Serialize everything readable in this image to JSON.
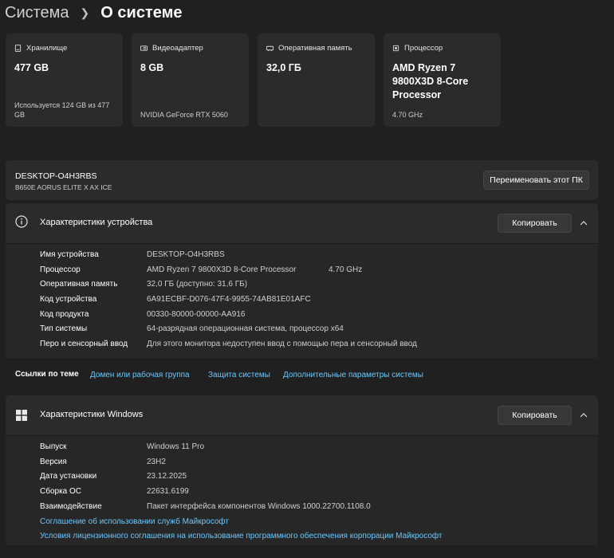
{
  "breadcrumb": {
    "parent": "Система",
    "current": "О системе"
  },
  "cards": [
    {
      "label": "Хранилище",
      "value": "477 GB",
      "sub": "Используется 124 GB из 477 GB",
      "icon": "storage-icon"
    },
    {
      "label": "Видеоадаптер",
      "value": "8 GB",
      "sub": "NVIDIA GeForce RTX 5060",
      "icon": "gpu-icon"
    },
    {
      "label": "Оперативная память",
      "value": "32,0 ГБ",
      "sub": "",
      "icon": "memory-icon"
    },
    {
      "label": "Процессор",
      "value": "AMD Ryzen 7 9800X3D 8-Core Processor",
      "sub": "4.70 GHz",
      "icon": "cpu-icon"
    }
  ],
  "device_bar": {
    "name": "DESKTOP-O4H3RBS",
    "model": "B650E AORUS ELITE X AX ICE",
    "rename_label": "Переименовать этот ПК"
  },
  "device_specs": {
    "title": "Характеристики устройства",
    "copy_label": "Копировать",
    "rows": [
      {
        "key": "Имя устройства",
        "value": "DESKTOP-O4H3RBS",
        "extra": ""
      },
      {
        "key": "Процессор",
        "value": "AMD Ryzen 7 9800X3D 8-Core Processor",
        "extra": "4.70 GHz"
      },
      {
        "key": "Оперативная память",
        "value": "32,0 ГБ (доступно: 31,6 ГБ)",
        "extra": ""
      },
      {
        "key": "Код устройства",
        "value": "6A91ECBF-D076-47F4-9955-74AB81E01AFC",
        "extra": ""
      },
      {
        "key": "Код продукта",
        "value": "00330-80000-00000-AA916",
        "extra": ""
      },
      {
        "key": "Тип системы",
        "value": "64-разрядная операционная система, процессор x64",
        "extra": ""
      },
      {
        "key": "Перо и сенсорный ввод",
        "value": "Для этого монитора недоступен ввод с помощью пера и сенсорный ввод",
        "extra": ""
      }
    ]
  },
  "related": {
    "label": "Ссылки по теме",
    "links": [
      "Домен или рабочая группа",
      "Защита системы",
      "Дополнительные параметры системы"
    ]
  },
  "windows_specs": {
    "title": "Характеристики Windows",
    "copy_label": "Копировать",
    "rows": [
      {
        "key": "Выпуск",
        "value": "Windows 11 Pro"
      },
      {
        "key": "Версия",
        "value": "23H2"
      },
      {
        "key": "Дата установки",
        "value": "23.12.2025"
      },
      {
        "key": "Сборка ОС",
        "value": "22631.6199"
      },
      {
        "key": "Взаимодействие",
        "value": "Пакет интерфейса компонентов Windows 1000.22700.1108.0"
      }
    ],
    "links": [
      "Соглашение об использовании служб Майкрософт",
      "Условия лицензионного соглашения на использование программного обеспечения корпорации Майкрософт"
    ]
  },
  "colors": {
    "background": "#202020",
    "card": "#2b2b2b",
    "link": "#68c8ff"
  }
}
